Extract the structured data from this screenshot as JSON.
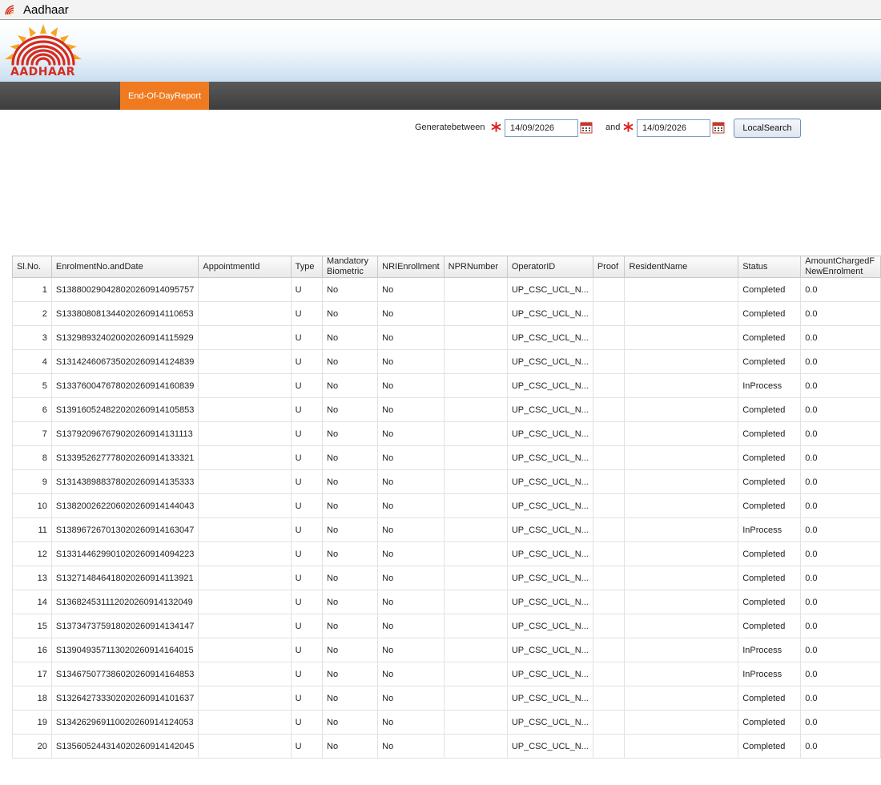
{
  "window": {
    "title": "Aadhaar"
  },
  "header": {
    "logo_text": "AADHAAR"
  },
  "nav": {
    "active_tab": "End-Of-Day Report"
  },
  "search": {
    "generate_label": "Generate between",
    "and_label": "and",
    "from_date": "14/09/2026",
    "to_date": "14/09/2026",
    "button_label": "Local Search"
  },
  "table": {
    "columns": {
      "sl": "Sl. No.",
      "enrolment": "Enrolment No. and Date",
      "appointment": "Appointment Id",
      "type": "Type",
      "mandatory_1": "Mandatory",
      "mandatory_2": "Biometric",
      "nri": "NRI Enrollment",
      "npr": "NPR Number",
      "operator": "Operator ID",
      "proof": "Proof",
      "resident": "Resident Name",
      "status": "Status",
      "amount_1": "Amount Charged F",
      "amount_2": "NewEnrolment"
    },
    "rows": [
      {
        "sl": "1",
        "enrolment": "S1388002904280202609140957 57",
        "appointment": "",
        "type": "U",
        "mandatory": "No",
        "nri": "No",
        "npr": "",
        "operator": "UP_CSC_UCL_N...",
        "proof": "",
        "resident": "",
        "status": "Completed",
        "amount": "0.0"
      },
      {
        "sl": "2",
        "enrolment": "S133808081344020260914110653",
        "appointment": "",
        "type": "U",
        "mandatory": "No",
        "nri": "No",
        "npr": "",
        "operator": "UP_CSC_UCL_N...",
        "proof": "",
        "resident": "",
        "status": "Completed",
        "amount": "0.0"
      },
      {
        "sl": "3",
        "enrolment": "S132989324020020260914115929",
        "appointment": "",
        "type": "U",
        "mandatory": "No",
        "nri": "No",
        "npr": "",
        "operator": "UP_CSC_UCL_N...",
        "proof": "",
        "resident": "",
        "status": "Completed",
        "amount": "0.0"
      },
      {
        "sl": "4",
        "enrolment": "S131424606735020260914124839",
        "appointment": "",
        "type": "U",
        "mandatory": "No",
        "nri": "No",
        "npr": "",
        "operator": "UP_CSC_UCL_N...",
        "proof": "",
        "resident": "",
        "status": "Completed",
        "amount": "0.0"
      },
      {
        "sl": "5",
        "enrolment": "S133760047678020260914160839",
        "appointment": "",
        "type": "U",
        "mandatory": "No",
        "nri": "No",
        "npr": "",
        "operator": "UP_CSC_UCL_N...",
        "proof": "",
        "resident": "",
        "status": "InProcess",
        "amount": "0.0"
      },
      {
        "sl": "6",
        "enrolment": "S139160524822020260914105853",
        "appointment": "",
        "type": "U",
        "mandatory": "No",
        "nri": "No",
        "npr": "",
        "operator": "UP_CSC_UCL_N...",
        "proof": "",
        "resident": "",
        "status": "Completed",
        "amount": "0.0"
      },
      {
        "sl": "7",
        "enrolment": "S137920967679020260914131113",
        "appointment": "",
        "type": "U",
        "mandatory": "No",
        "nri": "No",
        "npr": "",
        "operator": "UP_CSC_UCL_N...",
        "proof": "",
        "resident": "",
        "status": "Completed",
        "amount": "0.0"
      },
      {
        "sl": "8",
        "enrolment": "S133952627778020260914133321",
        "appointment": "",
        "type": "U",
        "mandatory": "No",
        "nri": "No",
        "npr": "",
        "operator": "UP_CSC_UCL_N...",
        "proof": "",
        "resident": "",
        "status": "Completed",
        "amount": "0.0"
      },
      {
        "sl": "9",
        "enrolment": "S131438988378020260914135333",
        "appointment": "",
        "type": "U",
        "mandatory": "No",
        "nri": "No",
        "npr": "",
        "operator": "UP_CSC_UCL_N...",
        "proof": "",
        "resident": "",
        "status": "Completed",
        "amount": "0.0"
      },
      {
        "sl": "10",
        "enrolment": "S138200262206020260914144043",
        "appointment": "",
        "type": "U",
        "mandatory": "No",
        "nri": "No",
        "npr": "",
        "operator": "UP_CSC_UCL_N...",
        "proof": "",
        "resident": "",
        "status": "Completed",
        "amount": "0.0"
      },
      {
        "sl": "11",
        "enrolment": "S138967267013020260914163047",
        "appointment": "",
        "type": "U",
        "mandatory": "No",
        "nri": "No",
        "npr": "",
        "operator": "UP_CSC_UCL_N...",
        "proof": "",
        "resident": "",
        "status": "InProcess",
        "amount": "0.0"
      },
      {
        "sl": "12",
        "enrolment": "S133144629901020260914094223",
        "appointment": "",
        "type": "U",
        "mandatory": "No",
        "nri": "No",
        "npr": "",
        "operator": "UP_CSC_UCL_N...",
        "proof": "",
        "resident": "",
        "status": "Completed",
        "amount": "0.0"
      },
      {
        "sl": "13",
        "enrolment": "S132714846418020260914113921",
        "appointment": "",
        "type": "U",
        "mandatory": "No",
        "nri": "No",
        "npr": "",
        "operator": "UP_CSC_UCL_N...",
        "proof": "",
        "resident": "",
        "status": "Completed",
        "amount": "0.0"
      },
      {
        "sl": "14",
        "enrolment": "S136824531112020260914132049",
        "appointment": "",
        "type": "U",
        "mandatory": "No",
        "nri": "No",
        "npr": "",
        "operator": "UP_CSC_UCL_N...",
        "proof": "",
        "resident": "",
        "status": "Completed",
        "amount": "0.0"
      },
      {
        "sl": "15",
        "enrolment": "S137347375918020260914134147",
        "appointment": "",
        "type": "U",
        "mandatory": "No",
        "nri": "No",
        "npr": "",
        "operator": "UP_CSC_UCL_N...",
        "proof": "",
        "resident": "",
        "status": "Completed",
        "amount": "0.0"
      },
      {
        "sl": "16",
        "enrolment": "S139049357113020260914164015",
        "appointment": "",
        "type": "U",
        "mandatory": "No",
        "nri": "No",
        "npr": "",
        "operator": "UP_CSC_UCL_N...",
        "proof": "",
        "resident": "",
        "status": "InProcess",
        "amount": "0.0"
      },
      {
        "sl": "17",
        "enrolment": "S134675077386020260914164853",
        "appointment": "",
        "type": "U",
        "mandatory": "No",
        "nri": "No",
        "npr": "",
        "operator": "UP_CSC_UCL_N...",
        "proof": "",
        "resident": "",
        "status": "InProcess",
        "amount": "0.0"
      },
      {
        "sl": "18",
        "enrolment": "S132642733302020260914101637",
        "appointment": "",
        "type": "U",
        "mandatory": "No",
        "nri": "No",
        "npr": "",
        "operator": "UP_CSC_UCL_N...",
        "proof": "",
        "resident": "",
        "status": "Completed",
        "amount": "0.0"
      },
      {
        "sl": "19",
        "enrolment": "S134262969110020260914124053",
        "appointment": "",
        "type": "U",
        "mandatory": "No",
        "nri": "No",
        "npr": "",
        "operator": "UP_CSC_UCL_N...",
        "proof": "",
        "resident": "",
        "status": "Completed",
        "amount": "0.0"
      },
      {
        "sl": "20",
        "enrolment": "S135605244314020260914142045",
        "appointment": "",
        "type": "U",
        "mandatory": "No",
        "nri": "No",
        "npr": "",
        "operator": "UP_CSC_UCL_N...",
        "proof": "",
        "resident": "",
        "status": "Completed",
        "amount": "0.0"
      }
    ]
  },
  "colors": {
    "accent_orange": "#f07a1f",
    "logo_red": "#d52b1e",
    "logo_sun": "#f5a623",
    "navbar_dark": "#3d3d3d",
    "required_star": "#e02020"
  }
}
